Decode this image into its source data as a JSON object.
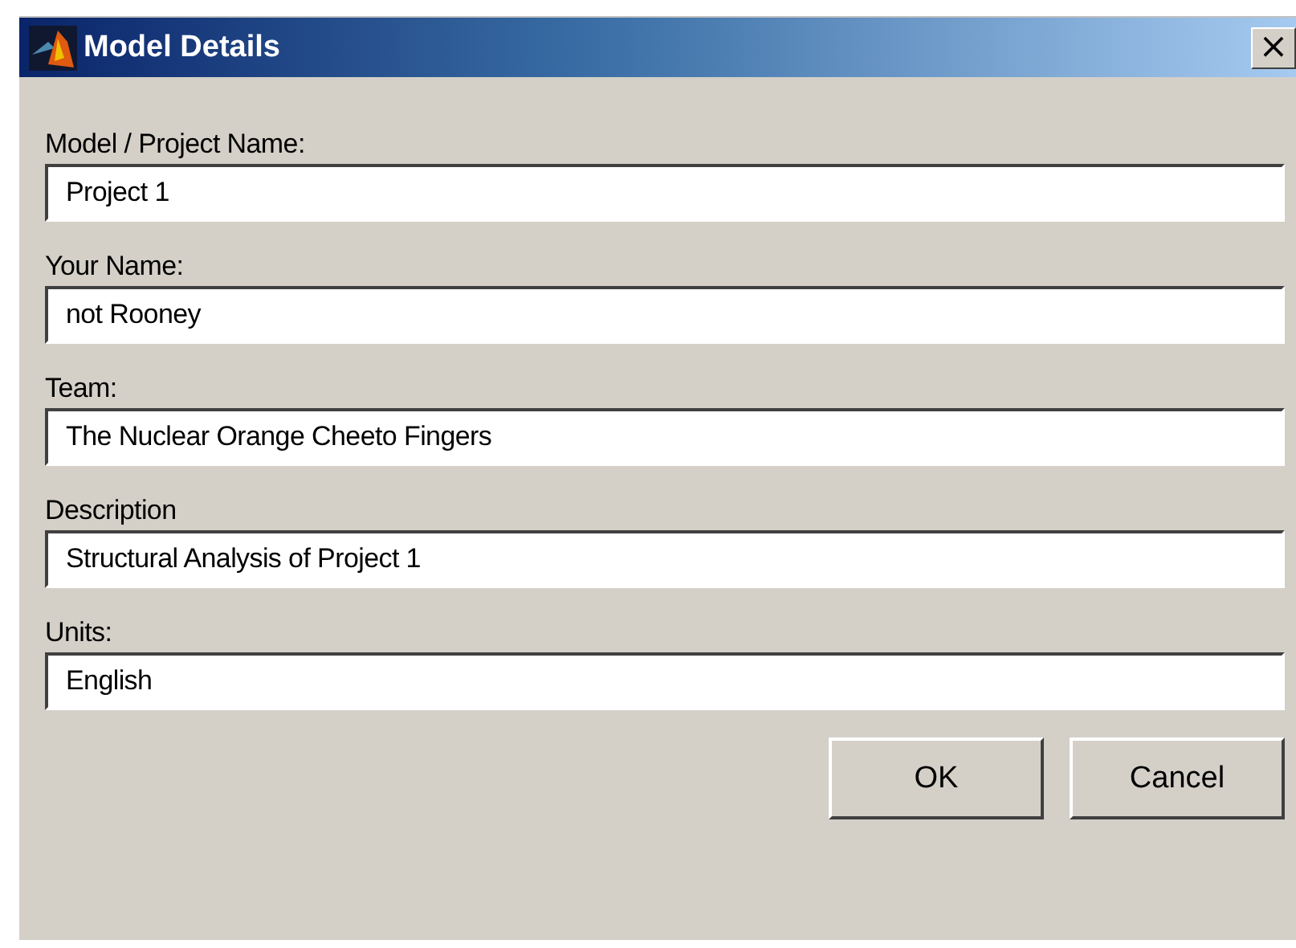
{
  "window": {
    "title": "Model Details",
    "close": "×"
  },
  "fields": [
    {
      "label": "Model / Project Name:",
      "value": "Project 1"
    },
    {
      "label": "Your Name:",
      "value": "not Rooney"
    },
    {
      "label": "Team:",
      "value": "The Nuclear Orange Cheeto Fingers"
    },
    {
      "label": "Description",
      "value": "Structural Analysis of Project 1"
    },
    {
      "label": "Units:",
      "value": "English"
    }
  ],
  "buttons": [
    "OK",
    "Cancel"
  ]
}
